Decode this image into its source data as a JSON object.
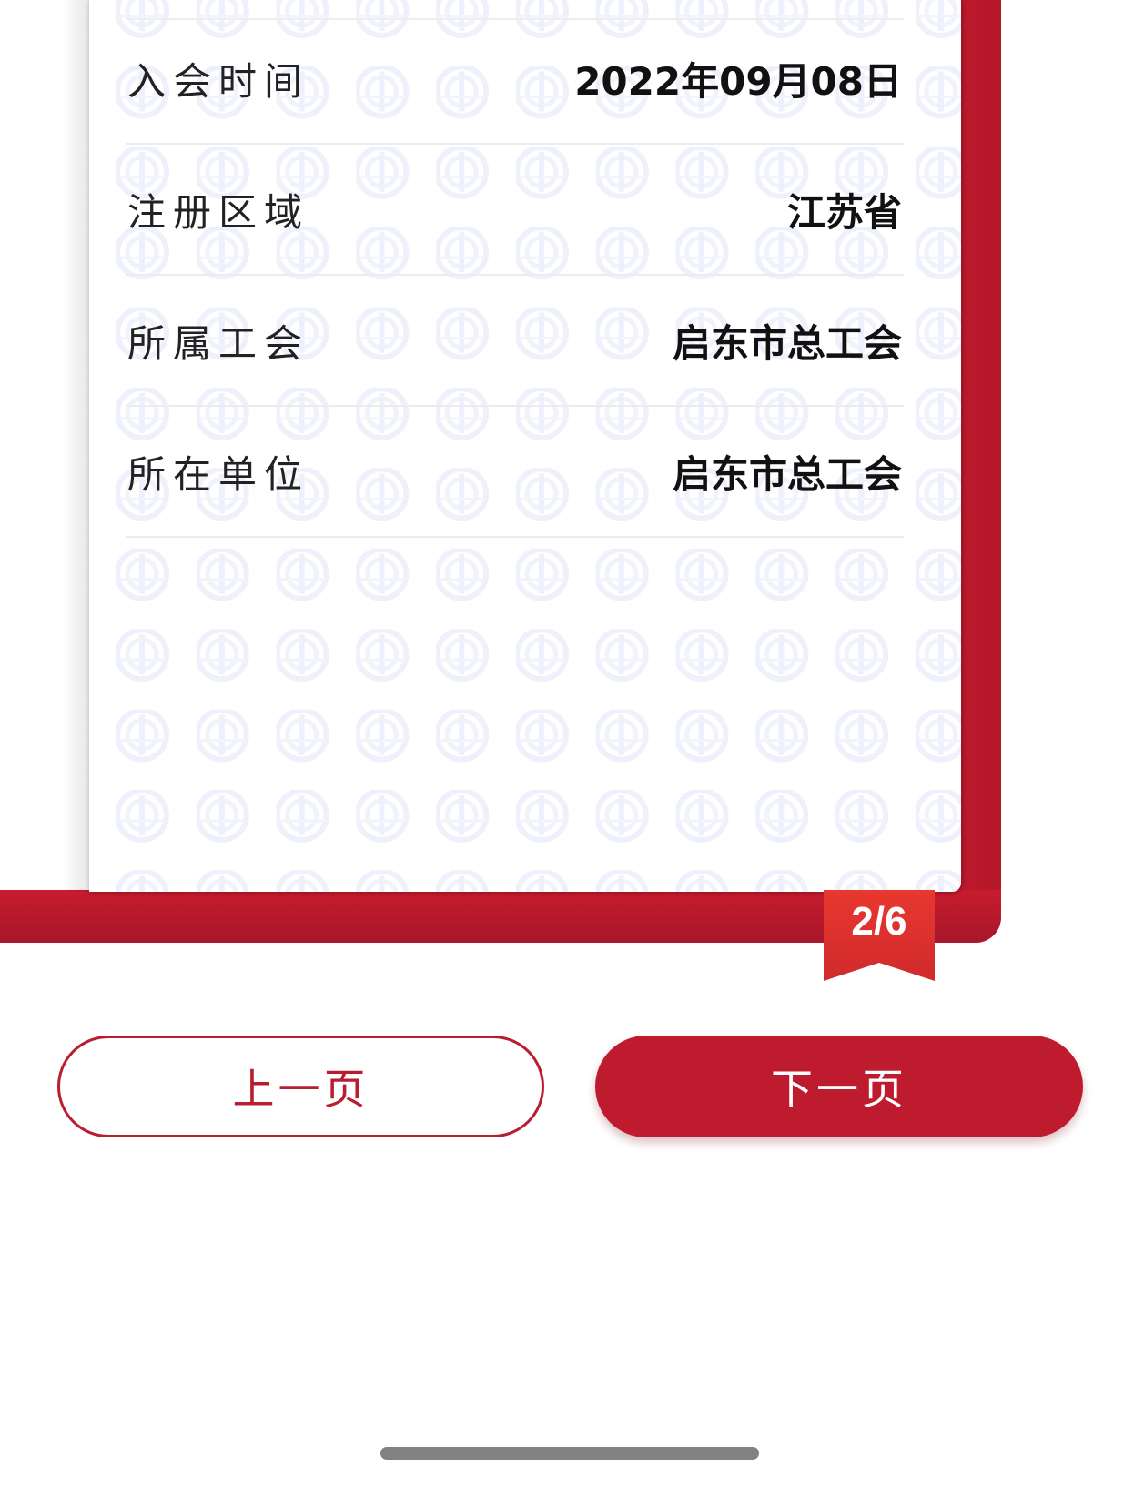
{
  "card": {
    "rows": [
      {
        "label": "入会时间",
        "value": "2022年09月08日"
      },
      {
        "label": "注册区域",
        "value": "江苏省"
      },
      {
        "label": "所属工会",
        "value": "启东市总工会"
      },
      {
        "label": "所在单位",
        "value": "启东市总工会"
      }
    ]
  },
  "pager": {
    "indicator": "2/6",
    "prev_label": "上一页",
    "next_label": "下一页"
  },
  "colors": {
    "brand_red": "#be1b2f",
    "badge_red": "#e0302f",
    "watermark_blue": "#eef0fb"
  },
  "icons": {
    "watermark": "union-emblem-icon"
  }
}
